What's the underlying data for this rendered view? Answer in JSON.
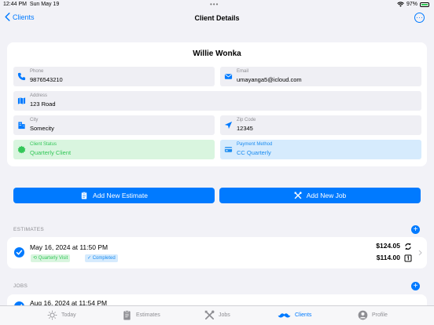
{
  "status_bar": {
    "time": "12:44 PM",
    "date": "Sun May 19",
    "battery": "97%"
  },
  "nav": {
    "back_label": "Clients",
    "title": "Client Details"
  },
  "client": {
    "name": "Willie Wonka",
    "phone": {
      "label": "Phone",
      "value": "9876543210"
    },
    "email": {
      "label": "Email",
      "value": "umayanga5@icloud.com"
    },
    "address": {
      "label": "Address",
      "value": "123 Road"
    },
    "city": {
      "label": "City",
      "value": "Somecity"
    },
    "zip": {
      "label": "Zip Code",
      "value": "12345"
    },
    "status": {
      "label": "Client Status",
      "value": "Quarterly Client"
    },
    "payment": {
      "label": "Payment Method",
      "value": "CC Quarterly"
    }
  },
  "actions": {
    "new_estimate": "Add New Estimate",
    "new_job": "Add New Job"
  },
  "estimates": {
    "header": "ESTIMATES",
    "items": [
      {
        "date": "May 16, 2024 at 11:50 PM",
        "tag1": "Quarterly Visit",
        "tag2": "Completed",
        "price_recurring": "$124.05",
        "price_once": "$114.00"
      }
    ]
  },
  "jobs": {
    "header": "JOBS",
    "items": [
      {
        "date": "Aug 16, 2024 at 11:54 PM"
      }
    ]
  },
  "tabs": [
    {
      "label": "Today",
      "icon": "sun-icon"
    },
    {
      "label": "Estimates",
      "icon": "clipboard-icon"
    },
    {
      "label": "Jobs",
      "icon": "tools-icon"
    },
    {
      "label": "Clients",
      "icon": "mustache-icon",
      "active": true
    },
    {
      "label": "Profile",
      "icon": "person-icon"
    }
  ],
  "colors": {
    "accent": "#007aff",
    "success": "#34c759",
    "background": "#f2f2f7"
  }
}
